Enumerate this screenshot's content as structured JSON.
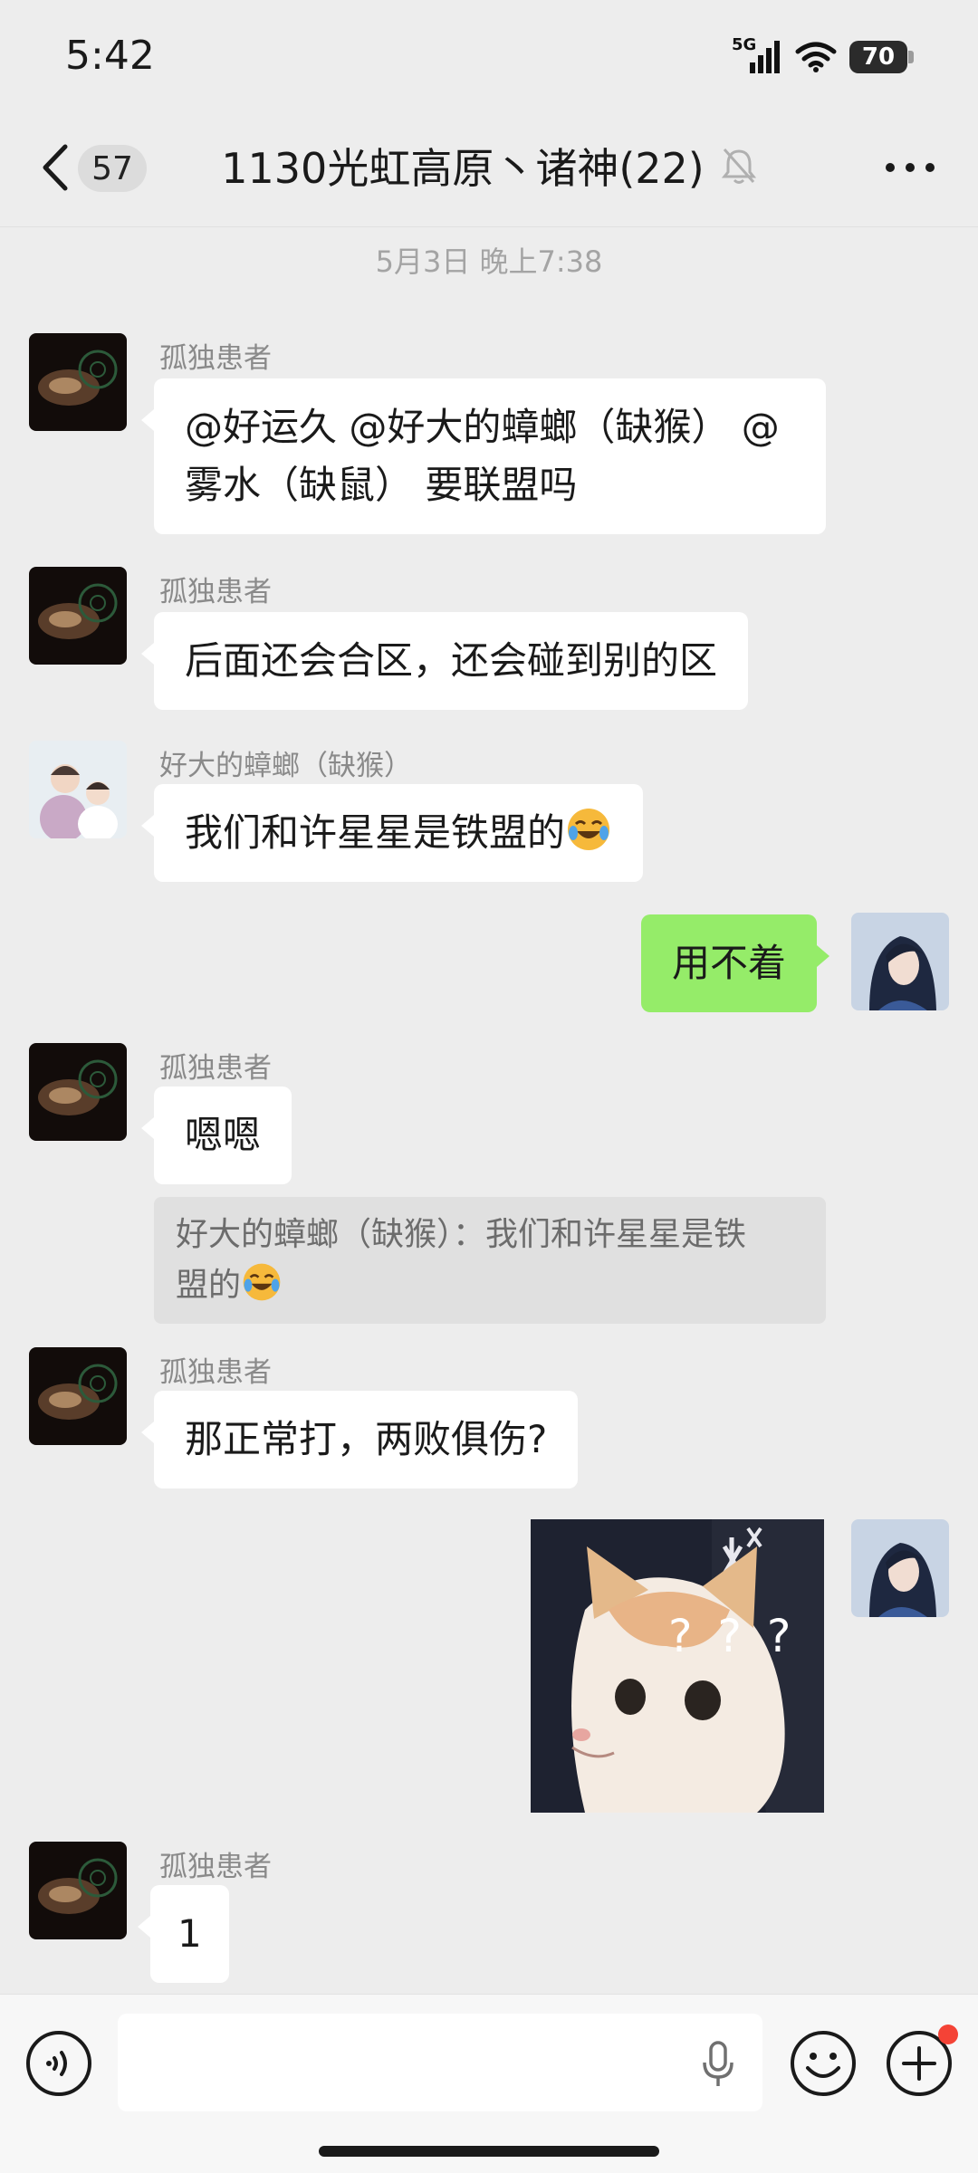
{
  "status_bar": {
    "time": "5:42",
    "network": "5G",
    "battery": "70"
  },
  "header": {
    "back_count": "57",
    "title": "1130光虹高原丶诸神(22)"
  },
  "timestamp": "5月3日 晚上7:38",
  "messages": [
    {
      "sender": "孤独患者",
      "text_line1": "@好运久 @好大的蟑螂（缺猴） @",
      "text_line2": "雾水（缺鼠） 要联盟吗"
    },
    {
      "sender": "孤独患者",
      "text": "后面还会合区，还会碰到别的区"
    },
    {
      "sender": "好大的蟑螂（缺猴）",
      "text": "我们和许星星是铁盟的",
      "emoji": "laughing-crying-emoji"
    },
    {
      "sender": "me",
      "text": "用不着"
    },
    {
      "sender": "孤独患者",
      "text": "嗯嗯",
      "quote_line1": "好大的蟑螂（缺猴）：我们和许星星是铁",
      "quote_line2": "盟的",
      "quote_emoji": "laughing-crying-emoji"
    },
    {
      "sender": "孤独患者",
      "text": "那正常打，两败俱伤?"
    },
    {
      "sender": "me",
      "sticker": "confused-cat-sticker",
      "sticker_text": "? ? ?"
    },
    {
      "sender": "孤独患者",
      "text": "1"
    }
  ],
  "colors": {
    "my_bubble": "#95ec69",
    "background": "#ededed",
    "notify_dot": "#f44336"
  },
  "icons": [
    "back-arrow-icon",
    "mute-bell-icon",
    "more-dots-icon",
    "voice-icon",
    "microphone-icon",
    "emoji-face-icon",
    "plus-icon"
  ]
}
